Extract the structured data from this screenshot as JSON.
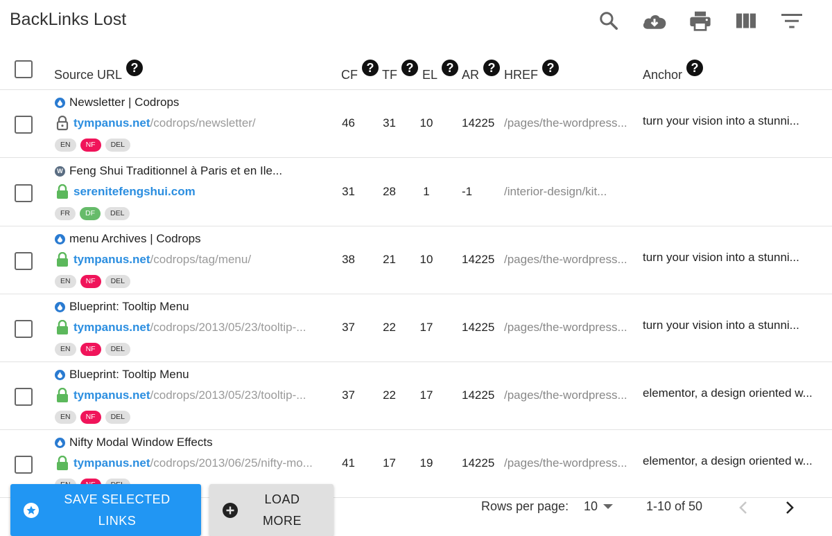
{
  "app": {
    "title": "BackLinks Lost"
  },
  "toolbar": {
    "icons": [
      "search-icon",
      "cloud-download-icon",
      "print-icon",
      "view-columns-icon",
      "filter-list-icon"
    ]
  },
  "columns": {
    "source": "Source URL",
    "cf": "CF",
    "tf": "TF",
    "el": "EL",
    "ar": "AR",
    "href": "HREF",
    "anchor": "Anchor",
    "help": "?"
  },
  "rows": [
    {
      "favicon": "drop",
      "title": "Newsletter | Codrops",
      "lock": "gray",
      "domain": "tympanus.net",
      "path": "/codrops/newsletter/",
      "badges": [
        "EN",
        "NF",
        "DEL"
      ],
      "cf": "46",
      "tf": "31",
      "el": "10",
      "ar": "14225",
      "href": "/pages/the-wordpress...",
      "anchor": "turn your vision into a stunni..."
    },
    {
      "favicon": "wp",
      "title": "Feng Shui Traditionnel à Paris et en Ile...",
      "lock": "green",
      "domain": "serenitefengshui.com",
      "path": "",
      "badges": [
        "FR",
        "DF",
        "DEL"
      ],
      "cf": "31",
      "tf": "28",
      "el": "1",
      "ar": "-1",
      "href": "/interior-design/kit...",
      "anchor": ""
    },
    {
      "favicon": "drop",
      "title": "menu Archives | Codrops",
      "lock": "green",
      "domain": "tympanus.net",
      "path": "/codrops/tag/menu/",
      "badges": [
        "EN",
        "NF",
        "DEL"
      ],
      "cf": "38",
      "tf": "21",
      "el": "10",
      "ar": "14225",
      "href": "/pages/the-wordpress...",
      "anchor": "turn your vision into a stunni..."
    },
    {
      "favicon": "drop",
      "title": "Blueprint: Tooltip Menu",
      "lock": "green",
      "domain": "tympanus.net",
      "path": "/codrops/2013/05/23/tooltip-...",
      "badges": [
        "EN",
        "NF",
        "DEL"
      ],
      "cf": "37",
      "tf": "22",
      "el": "17",
      "ar": "14225",
      "href": "/pages/the-wordpress...",
      "anchor": "turn your vision into a stunni..."
    },
    {
      "favicon": "drop",
      "title": "Blueprint: Tooltip Menu",
      "lock": "green",
      "domain": "tympanus.net",
      "path": "/codrops/2013/05/23/tooltip-...",
      "badges": [
        "EN",
        "NF",
        "DEL"
      ],
      "cf": "37",
      "tf": "22",
      "el": "17",
      "ar": "14225",
      "href": "/pages/the-wordpress...",
      "anchor": "elementor, a design oriented w..."
    },
    {
      "favicon": "drop",
      "title": "Nifty Modal Window Effects",
      "lock": "green",
      "domain": "tympanus.net",
      "path": "/codrops/2013/06/25/nifty-mo...",
      "badges": [
        "EN",
        "NF",
        "DEL"
      ],
      "cf": "41",
      "tf": "17",
      "el": "19",
      "ar": "14225",
      "href": "/pages/the-wordpress...",
      "anchor": "elementor, a design oriented w..."
    }
  ],
  "footer": {
    "save_line1": "SAVE SELECTED",
    "save_line2": "LINKS",
    "load_line1": "LOAD",
    "load_line2": "MORE",
    "rows_per_page_label": "Rows per page:",
    "rows_per_page_value": "10",
    "range": "1-10 of 50"
  },
  "colors": {
    "accent": "#2196f3",
    "link": "#2b8ee0",
    "nofollow": "#f0145a",
    "dofollow": "#66bb6a",
    "lock_green": "#5cb85c",
    "lock_gray": "#666666"
  }
}
